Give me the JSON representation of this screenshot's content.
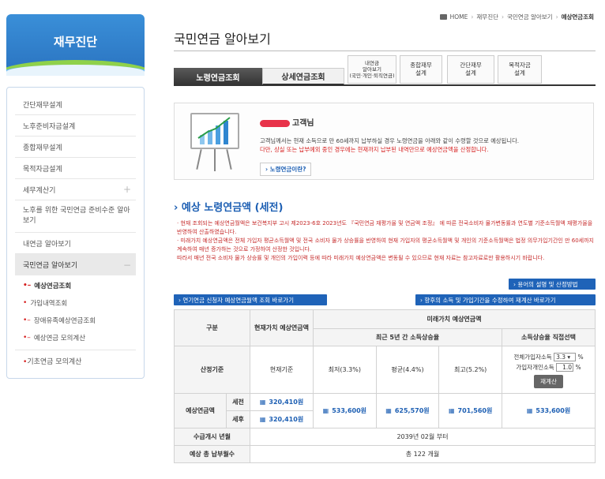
{
  "brand": {
    "title": "재무진단"
  },
  "sidebar": {
    "items": [
      {
        "label": "간단재무설계"
      },
      {
        "label": "노후준비자금설계"
      },
      {
        "label": "종합재무설계"
      },
      {
        "label": "목적자금설계"
      },
      {
        "label": "세무계산기",
        "expander": "+"
      },
      {
        "label": "노후를 위한 국민연금 준비수준 알아보기"
      },
      {
        "label": "내연금 알아보기"
      },
      {
        "label": "국민연금 알아보기",
        "expander": "−"
      }
    ],
    "subitems": [
      {
        "label": "예상연금조회"
      },
      {
        "label": "가입내역조회"
      },
      {
        "label": "장애유족예상연금조회"
      },
      {
        "label": "예상연금 모의계산"
      }
    ],
    "last_item": "기초연금 모의계산"
  },
  "breadcrumb": {
    "home": "HOME",
    "b1": "재무진단",
    "b2": "국민연금 알아보기",
    "b3": "예상연금조회"
  },
  "page_title": "국민연금 알아보기",
  "tabs": {
    "t1": "노령연금조회",
    "t2": "상세연금조회"
  },
  "subtabs": {
    "a1": "내연금",
    "a2": "알아보기",
    "a3": "(국민·개인·퇴직연금)",
    "b1": "종합재무",
    "b2": "설계",
    "c1": "간단재무",
    "c2": "설계",
    "d1": "목적자금",
    "d2": "설계"
  },
  "info": {
    "greeting_suffix": "고객님",
    "line1": "고객님께서는 현재 소득으로 만 60세까지 납부하실 경우 노령연금을 아래와 같이 수령할 것으로 예상됩니다.",
    "line2": "다만, 상실 또는 납부예외 중인 경우에는 현재까지 납부된 내역만으로 예상연금액을 산정합니다.",
    "link": "› 노령연금이란?"
  },
  "section_title": "› 예상 노령연금액 (세전)",
  "notes": {
    "n1": "· 현재 조회되는 예상연금월액은 보건복지부 고시 제2023-6호 2023년도 『국민연금 재평가율 및 연금액 조정』 에 따른 전국소비자 물가변동률과 연도별 기준소득월액 재평가율을 반영하여 산출하였습니다.",
    "n2": "· 미래가치 예상연금액은 전체 가입자 평균소득월액 및 전국 소비자 물가 상승률을 반영하여 현재 가입자의 평균소득월액 및 개인의 기준소득월액은 법정 의무가입기간인 만 60세까지 계속하여 매년 증가하는 것으로 가정하여 산정한 것입니다.",
    "n3": "따라서 매년 전국 소비자 물가 상승률 및 개인의 가입이력 등에 따라 미래가치 예상연금액은 변동될 수 있으므로 현재 자료는 참고자료로만 활용하시기 바랍니다."
  },
  "buttons": {
    "terms": "› 용어의 설명 및 산정방법",
    "public": "› 연기연금 신청자 예상연금월액 조회 바로가기",
    "future": "› 향후의 소득 및 가입기간을 수정하여 재계산 바로가기"
  },
  "table": {
    "h_category": "구분",
    "h_present": "현재가치 예상연금액",
    "h_future": "미래가치 예상연금액",
    "h_recent5": "최근 5년 간 소득상승율",
    "h_direct": "소득상승율 직접선택",
    "basis_label": "산정기준",
    "basis_present": "현재기준",
    "low": "최저(3.3%)",
    "avg": "평균(4.4%)",
    "high": "최고(5.2%)",
    "rate_all_label": "전체가입자소득",
    "rate_all_value": "3.3",
    "rate_self_label": "가입자개인소득",
    "rate_self_value": "1.0",
    "pct": "%",
    "recalc": "재계산",
    "pension_label": "예상연금액",
    "pre_tax": "세전",
    "post_tax": "세후",
    "present_pre": "320,410원",
    "present_post": "320,410원",
    "future_low": "533,600원",
    "future_avg": "625,570원",
    "future_high": "701,560원",
    "future_direct": "533,600원",
    "start_label": "수급개시 년월",
    "start_value": "2039년 02월 부터",
    "months_label": "예상 총 납부월수",
    "months_value": "총 122 개월"
  }
}
